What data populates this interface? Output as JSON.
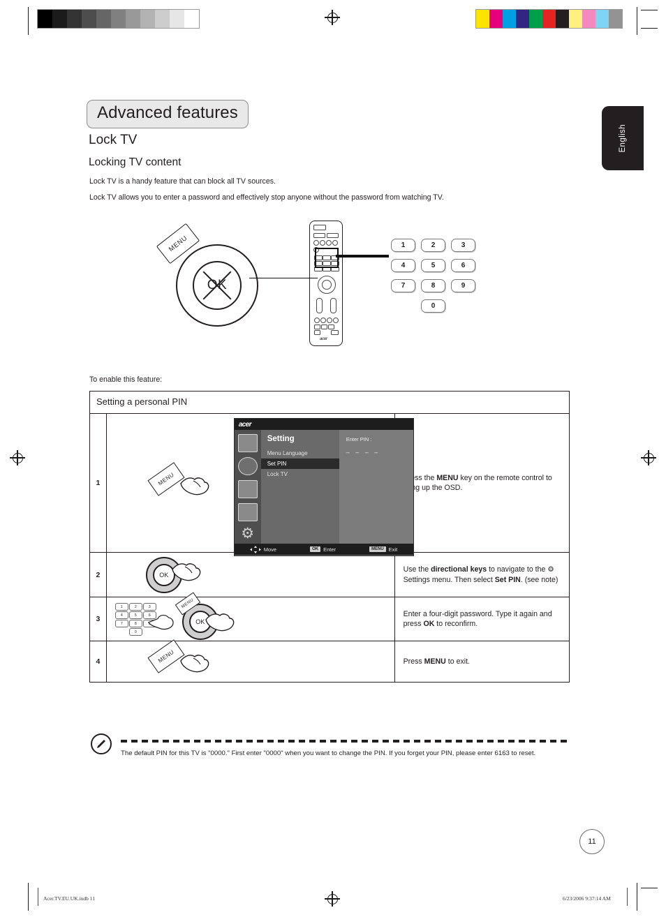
{
  "document": {
    "chapter_title": "Advanced features",
    "section_title": "Lock TV",
    "subsection_title": "Locking TV content",
    "intro_paragraph_1": "Lock TV is a handy feature that can block all TV sources.",
    "intro_paragraph_2": "Lock TV allows you to enter a password and effectively stop anyone without the password from watching TV.",
    "lead_in": "To enable this feature:",
    "language_tab": "English",
    "page_number": "11"
  },
  "diagram": {
    "ok_label": "OK",
    "menu_label": "MENU",
    "remote_brand": "acer",
    "keypad": [
      "1",
      "2",
      "3",
      "4",
      "5",
      "6",
      "7",
      "8",
      "9",
      "0"
    ]
  },
  "table": {
    "header": "Setting a personal PIN",
    "rows": [
      {
        "number": "1",
        "instruction_html": "Press the <b>MENU</b> key on the remote control to bring up the OSD."
      },
      {
        "number": "2",
        "instruction_html": "Use the <b>directional keys</b> to navigate to the ⚙ Settings menu. Then select <b>Set PIN</b>. (see note)"
      },
      {
        "number": "3",
        "instruction_html": "Enter a four-digit password. Type it again and press <b>OK</b> to reconfirm."
      },
      {
        "number": "4",
        "instruction_html": "Press <b>MENU</b> to exit."
      }
    ]
  },
  "osd": {
    "brand": "acer",
    "title": "Setting",
    "menu_items": [
      {
        "label": "Menu Language",
        "selected": false
      },
      {
        "label": "Set PIN",
        "selected": true
      },
      {
        "label": "Lock TV",
        "selected": false
      }
    ],
    "pin_prompt": "Enter PIN :",
    "pin_dashes": "– – – –",
    "footer_move": "Move",
    "footer_enter": "Enter",
    "footer_exit": "Exit",
    "key_ok": "OK",
    "key_menu": "MENU"
  },
  "note": {
    "text": "The default PIN for this TV is \"0000.\" First enter \"0000\" when you want to change the PIN. If you forget your PIN, please enter 6163 to reset."
  },
  "footer": {
    "filename": "Acer.TV.EU.UK.indb   11",
    "timestamp": "6/23/2006   9:37:14 AM"
  },
  "calibration": {
    "grayscale": [
      "#000000",
      "#1b1b1b",
      "#333333",
      "#4d4d4d",
      "#666666",
      "#808080",
      "#999999",
      "#b3b3b3",
      "#cccccc",
      "#e6e6e6",
      "#ffffff"
    ],
    "colors": [
      "#ffe400",
      "#e6007e",
      "#00a0e3",
      "#312783",
      "#00a04b",
      "#e52421",
      "#231f20",
      "#fff07f",
      "#f489c0",
      "#7fd3f4",
      "#939393"
    ]
  },
  "minikeys": [
    "1",
    "2",
    "3",
    "4",
    "5",
    "6",
    "7",
    "8",
    "9",
    "0"
  ]
}
